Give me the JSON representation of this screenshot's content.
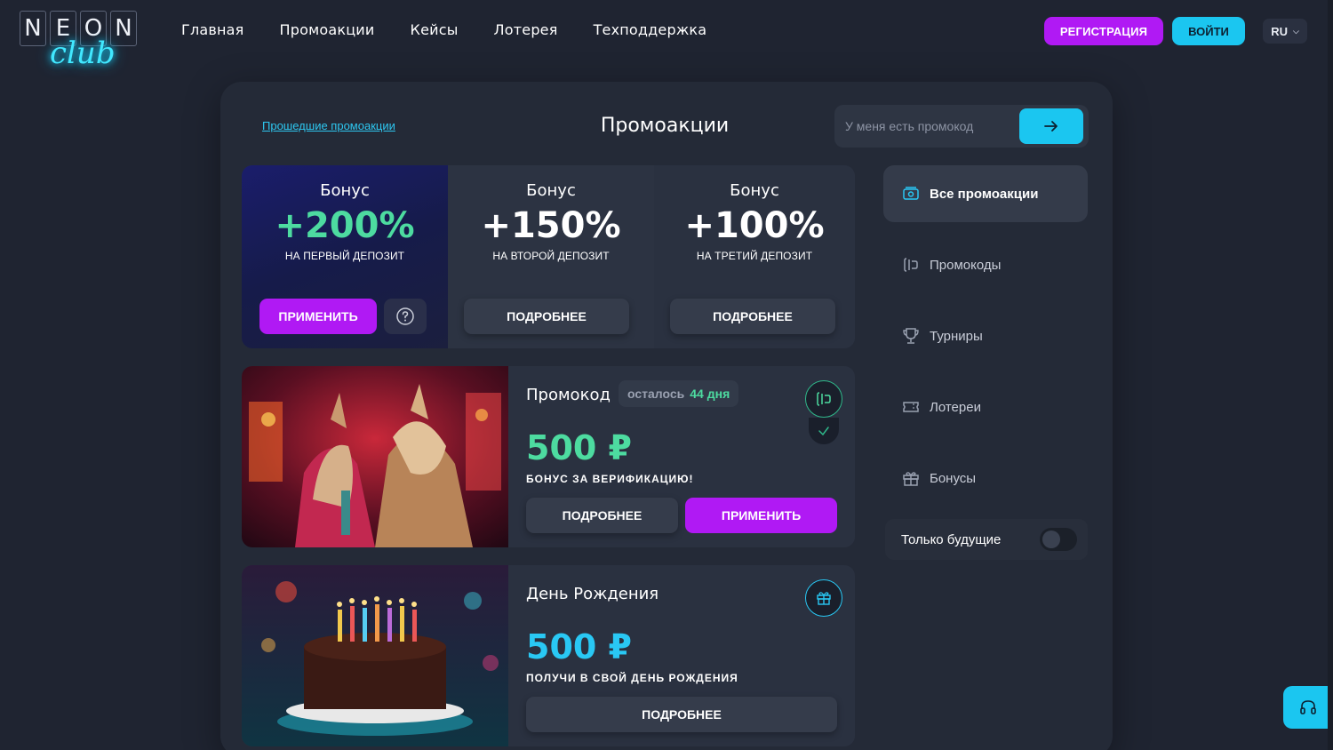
{
  "logo": {
    "letters": [
      "N",
      "E",
      "O",
      "N"
    ],
    "script": "club"
  },
  "nav": [
    "Главная",
    "Промоакции",
    "Кейсы",
    "Лотерея",
    "Техподдержка"
  ],
  "header": {
    "register_label": "РЕГИСТРАЦИЯ",
    "login_label": "ВОЙТИ",
    "language": "RU"
  },
  "page": {
    "past_link": "Прошедшие промоакции",
    "title": "Промоакции",
    "promo_placeholder": "У меня есть промокод"
  },
  "bonuses": [
    {
      "label": "Бонус",
      "value": "+200%",
      "sub": "НА ПЕРВЫЙ ДЕПОЗИТ",
      "primary_button": "ПРИМЕНИТЬ"
    },
    {
      "label": "Бонус",
      "value": "+150%",
      "sub": "НА ВТОРОЙ ДЕПОЗИТ",
      "primary_button": "ПОДРОБНЕЕ"
    },
    {
      "label": "Бонус",
      "value": "+100%",
      "sub": "НА ТРЕТИЙ ДЕПОЗИТ",
      "primary_button": "ПОДРОБНЕЕ"
    }
  ],
  "promos": [
    {
      "title": "Промокод",
      "days_prefix": "осталось",
      "days_value": "44 дня",
      "amount": "500 ₽",
      "description": "БОНУС ЗА ВЕРИФИКАЦИЮ!",
      "more_label": "ПОДРОБНЕЕ",
      "apply_label": "ПРИМЕНИТЬ"
    },
    {
      "title": "День Рождения",
      "amount": "500 ₽",
      "description": "ПОЛУЧИ В СВОЙ ДЕНЬ РОЖДЕНИЯ",
      "more_label": "ПОДРОБНЕЕ"
    }
  ],
  "sidebar": {
    "items": [
      {
        "label": "Все промоакции",
        "icon": "all-promos-icon"
      },
      {
        "label": "Промокоды",
        "icon": "promocode-icon"
      },
      {
        "label": "Турниры",
        "icon": "trophy-icon"
      },
      {
        "label": "Лотереи",
        "icon": "ticket-icon"
      },
      {
        "label": "Бонусы",
        "icon": "gift-icon"
      }
    ],
    "toggle_label": "Только будущие",
    "toggle_on": false
  },
  "colors": {
    "accent_purple": "#b019f4",
    "accent_cyan": "#1bc6f0",
    "green": "#4ddba0",
    "background": "#1f2431",
    "panel": "#242a37"
  }
}
